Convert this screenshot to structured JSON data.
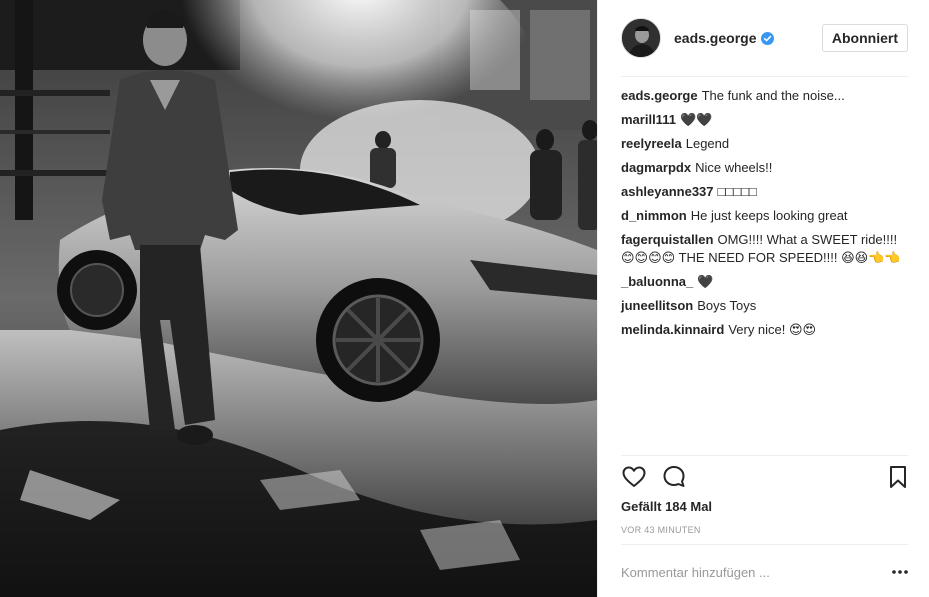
{
  "post": {
    "photo_alt": "Black and white photo of a man standing in front of a silver sports car",
    "header": {
      "username": "eads.george",
      "follow_label": "Abonniert"
    },
    "caption": {
      "user": "eads.george",
      "text": "The funk and the noise..."
    },
    "comments": [
      {
        "user": "marill111",
        "text": "🖤🖤"
      },
      {
        "user": "reelyreela",
        "text": "Legend"
      },
      {
        "user": "dagmarpdx",
        "text": "Nice wheels!!"
      },
      {
        "user": "ashleyanne337",
        "text": "□□□□□"
      },
      {
        "user": "d_nimmon",
        "text": "He just keeps looking great"
      },
      {
        "user": "fagerquistallen",
        "text": "OMG!!!! What a SWEET ride!!!! 😊😊😊😊 THE NEED FOR SPEED!!!! 😆😆👈👈"
      },
      {
        "user": "_baluonna_",
        "text": "🖤"
      },
      {
        "user": "juneellitson",
        "text": "Boys Toys"
      },
      {
        "user": "melinda.kinnaird",
        "text": "Very nice! 😍😍"
      }
    ],
    "likes_text": "Gefällt 184 Mal",
    "timestamp": "VOR 43 MINUTEN",
    "comment_placeholder": "Kommentar hinzufügen ...",
    "icons": {
      "like": "heart-icon",
      "comment": "comment-icon",
      "save": "bookmark-icon",
      "more": "more-options-icon",
      "verified": "verified-badge-icon"
    },
    "colors": {
      "verified_blue": "#3897f0",
      "text": "#262626",
      "muted": "#999999",
      "border": "#efefef"
    }
  }
}
